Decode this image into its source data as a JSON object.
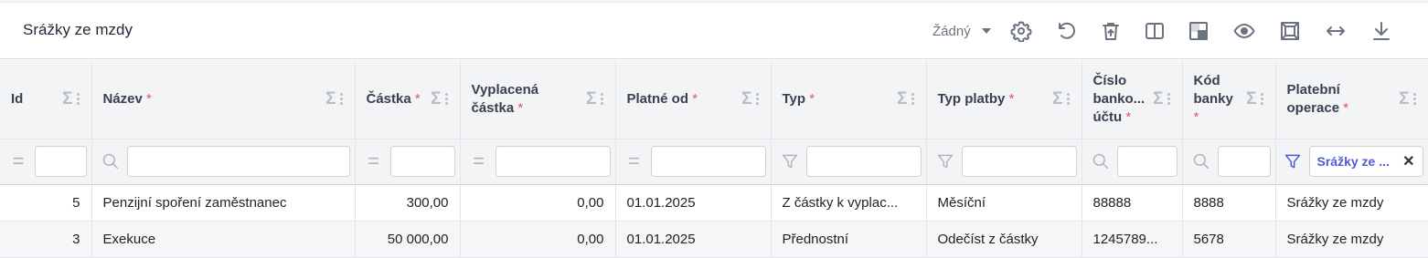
{
  "panel": {
    "title": "Srážky ze mzdy"
  },
  "toolbar": {
    "view_select": "Žádný",
    "icons": [
      "gear-icon",
      "undo-icon",
      "delete-icon",
      "columns-icon",
      "layout-icon",
      "eye-icon",
      "fit-icon",
      "expand-width-icon",
      "download-icon"
    ]
  },
  "columns": [
    {
      "label": "Id",
      "required": false
    },
    {
      "label": "Název",
      "required": true
    },
    {
      "label": "Částka",
      "required": true
    },
    {
      "label": "Vyplacená částka",
      "required": true
    },
    {
      "label": "Platné od",
      "required": true
    },
    {
      "label": "Typ",
      "required": true
    },
    {
      "label": "Typ platby",
      "required": true
    },
    {
      "label": "Číslo banko... účtu",
      "required": true
    },
    {
      "label": "Kód banky",
      "required": true
    },
    {
      "label": "Platební operace",
      "required": true
    }
  ],
  "filters": {
    "operace_value": "Srážky ze ..."
  },
  "rows": [
    {
      "id": "5",
      "nazev": "Penzijní spoření zaměstnanec",
      "castka": "300,00",
      "vyplacena": "0,00",
      "platne_od": "01.01.2025",
      "typ": "Z částky k vyplac...",
      "typ_platby": "Měsíční",
      "cislo_uctu": "88888",
      "kod_banky": "8888",
      "operace": "Srážky ze mzdy"
    },
    {
      "id": "3",
      "nazev": "Exekuce",
      "castka": "50 000,00",
      "vyplacena": "0,00",
      "platne_od": "01.01.2025",
      "typ": "Přednostní",
      "typ_platby": "Odečíst z částky",
      "cislo_uctu": "1245789...",
      "kod_banky": "5678",
      "operace": "Srážky ze mzdy"
    }
  ],
  "required_marker": "*",
  "colors": {
    "accent": "#4f5bd5",
    "required": "#e05563",
    "header_bg": "#f3f4f6"
  }
}
